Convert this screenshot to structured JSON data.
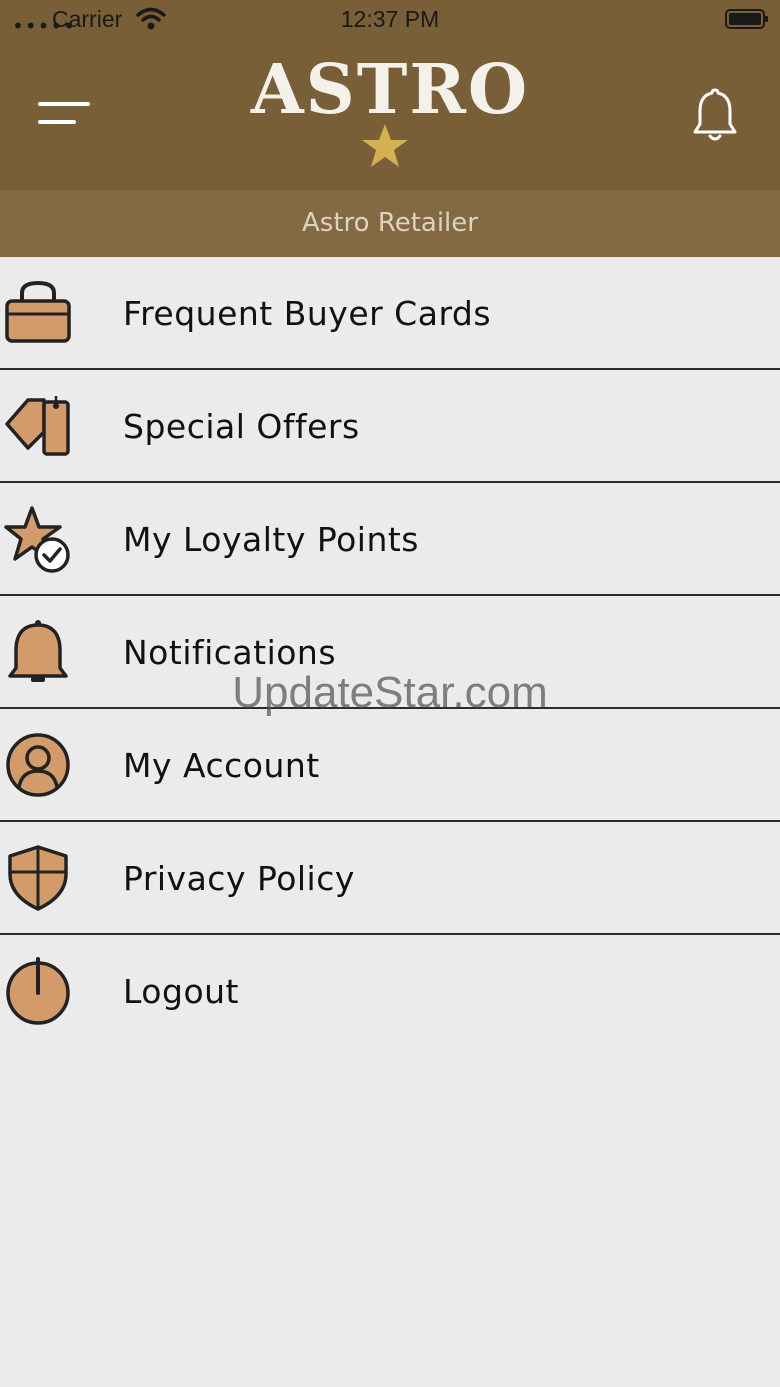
{
  "status_bar": {
    "signal": "•••••",
    "carrier": "Carrier",
    "time": "12:37 PM"
  },
  "header": {
    "logo_text": "ASTRO",
    "menu_icon": "hamburger-menu-icon",
    "bell_icon": "bell-icon"
  },
  "subheader": {
    "retailer_name": "Astro Retailer"
  },
  "menu": {
    "items": [
      {
        "label": "Frequent Buyer Cards",
        "icon": "shopping-bag-icon"
      },
      {
        "label": "Special Offers",
        "icon": "price-tag-icon"
      },
      {
        "label": "My Loyalty Points",
        "icon": "star-check-icon"
      },
      {
        "label": "Notifications",
        "icon": "bell-icon"
      },
      {
        "label": "My Account",
        "icon": "user-profile-icon"
      },
      {
        "label": "Privacy Policy",
        "icon": "shield-icon"
      },
      {
        "label": "Logout",
        "icon": "power-icon"
      }
    ]
  },
  "watermark": "UpdateStar.com",
  "colors": {
    "header_bg": "#785f38",
    "subheader_bg": "#836a42",
    "icon_fill": "#d39b69",
    "star_gold": "#d4b050",
    "list_bg": "#ebebeb"
  }
}
